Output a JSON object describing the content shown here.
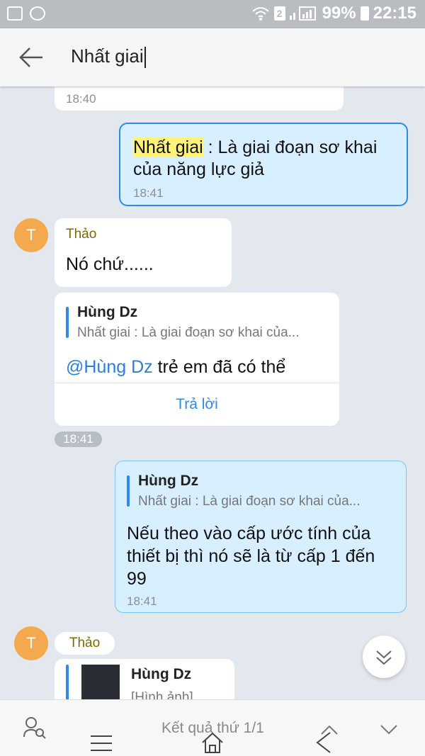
{
  "status_bar": {
    "sim_badge": "2",
    "battery": "99%",
    "time": "22:15"
  },
  "search": {
    "query": "Nhất giai"
  },
  "messages": {
    "prev_time": "18:40",
    "m1": {
      "highlight": "Nhất giai",
      "text_line1": " : Là giai đoạn sơ khai",
      "text_line2": "của năng lực giả",
      "time": "18:41"
    },
    "m2": {
      "avatar_letter": "T",
      "sender": "Thảo",
      "text": "Nó chứ......"
    },
    "m3": {
      "quote_name": "Hùng Dz",
      "quote_text": "Nhất giai : Là giai đoạn sơ khai của...",
      "mention": "@Hùng Dz",
      "text": " trẻ em đã có thể",
      "reply_label": "Trả lời",
      "time": "18:41"
    },
    "m4": {
      "quote_name": "Hùng Dz",
      "quote_text": "Nhất giai : Là giai đoạn sơ khai của...",
      "text": "Nếu theo vào cấp ước tính của thiết bị thì nó sẽ là từ cấp 1 đến 99",
      "time": "18:41"
    },
    "m5": {
      "avatar_letter": "T",
      "sender": "Thảo",
      "quote_name": "Hùng Dz",
      "quote_text": "[Hình ảnh]"
    }
  },
  "bottom": {
    "result_label": "Kết quả thứ 1/1"
  },
  "colors": {
    "accent": "#2c8be8",
    "sent_bubble": "#d7efff",
    "avatar": "#f5a94e",
    "highlight": "#fff37a"
  }
}
